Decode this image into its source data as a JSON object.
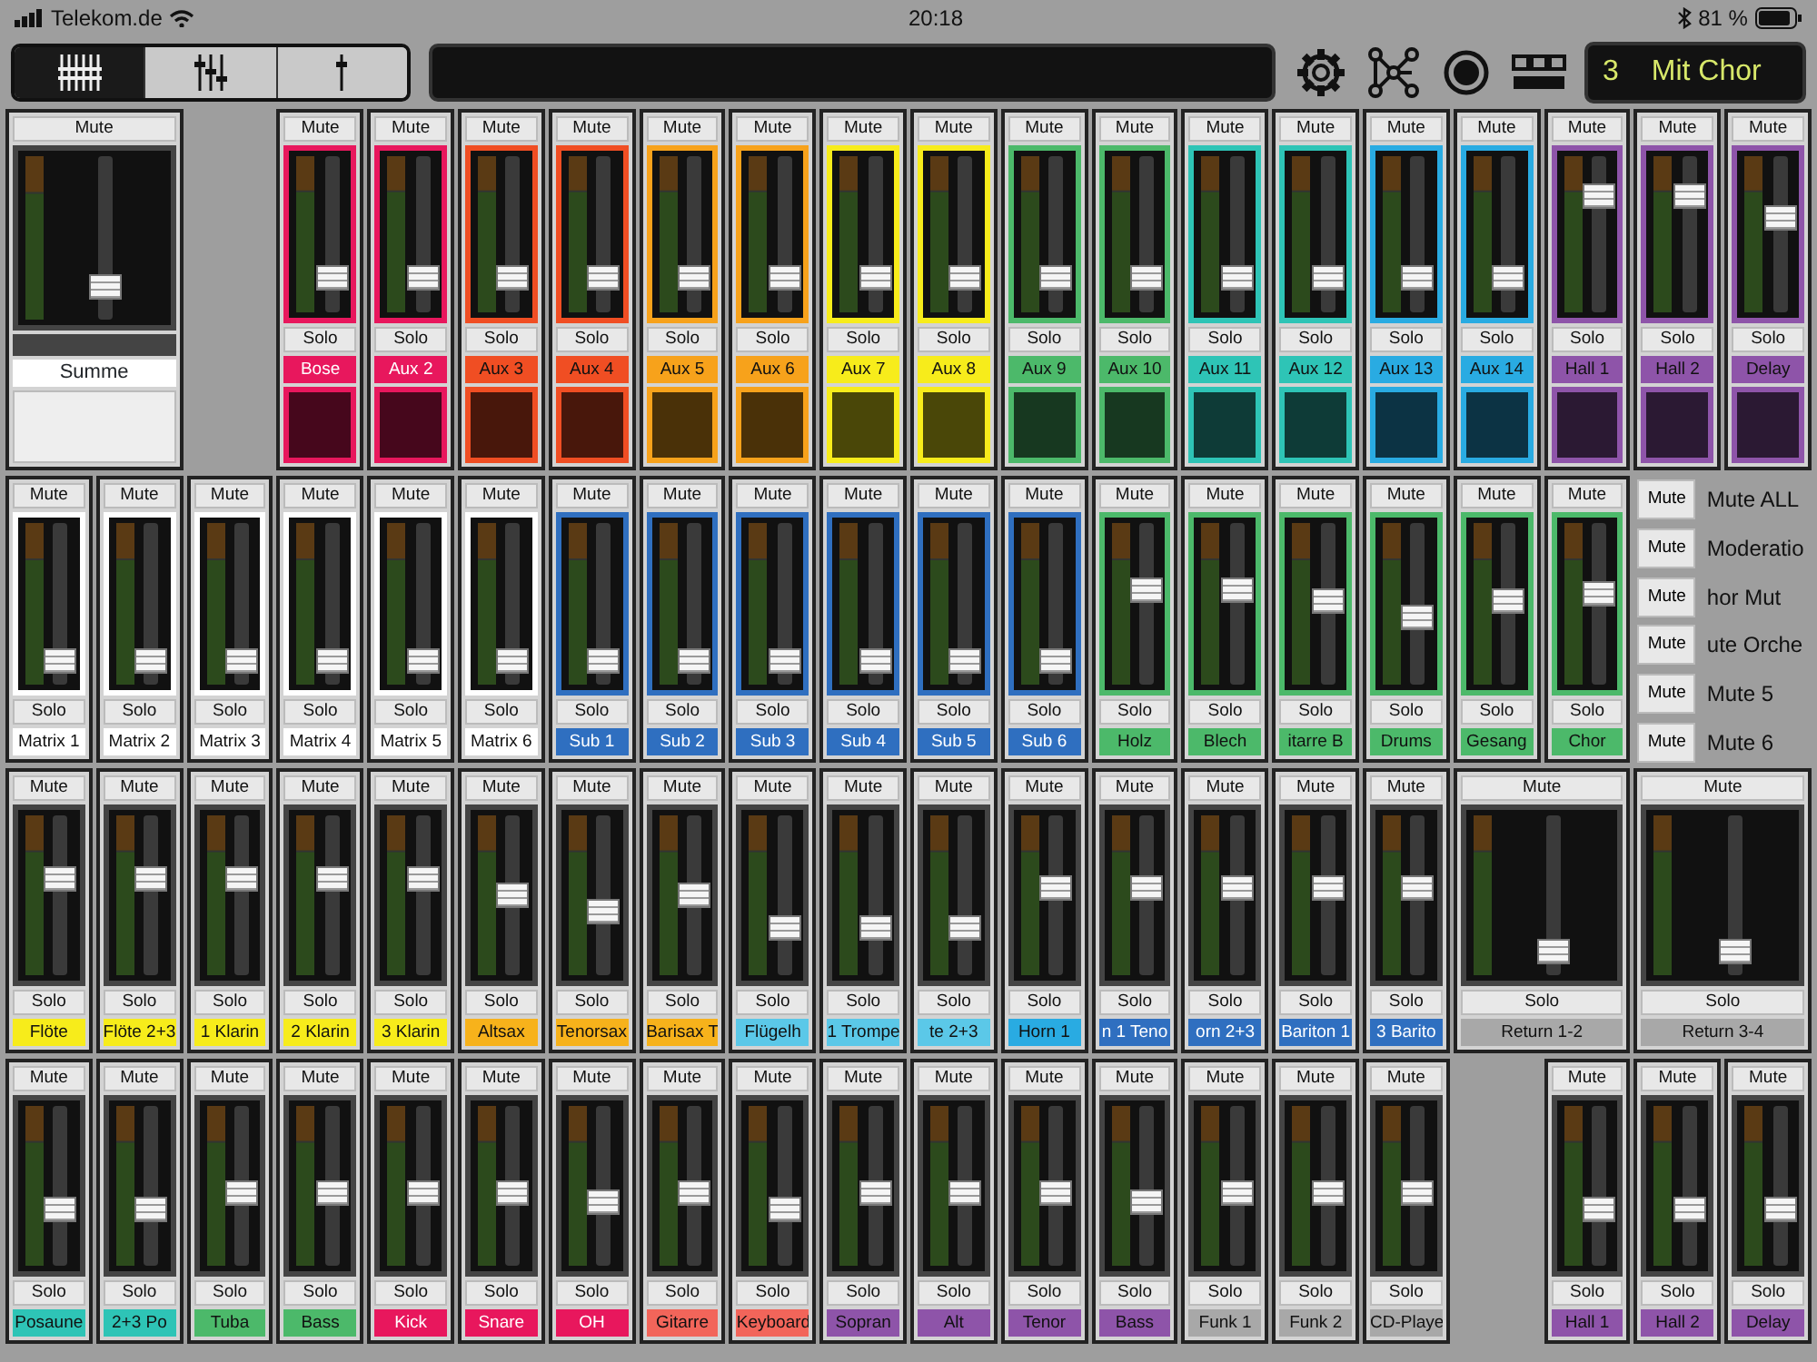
{
  "status_bar": {
    "carrier": "Telekom.de",
    "time": "20:18",
    "battery": "81 %"
  },
  "toolbar": {
    "view_tabs": [
      {
        "kind": "bank",
        "selected": true
      },
      {
        "kind": "group",
        "selected": false
      },
      {
        "kind": "single",
        "selected": false
      }
    ],
    "scene": {
      "number": "3",
      "name": "Mit Chor"
    }
  },
  "master": {
    "mute": "Mute",
    "name": "Summe",
    "level": 0.2
  },
  "rows": [
    {
      "kind": "sends",
      "strips": [
        {
          "kind": "narrow",
          "mute": "Mute",
          "solo": "Solo",
          "name": "Bose",
          "color": "#e8175d",
          "level": 0.22
        },
        {
          "kind": "narrow",
          "mute": "Mute",
          "solo": "Solo",
          "name": "Aux 2",
          "color": "#e8175d",
          "level": 0.22
        },
        {
          "kind": "narrow",
          "mute": "Mute",
          "solo": "Solo",
          "name": "Aux 3",
          "color": "#f04e23",
          "level": 0.22
        },
        {
          "kind": "narrow",
          "mute": "Mute",
          "solo": "Solo",
          "name": "Aux 4",
          "color": "#f04e23",
          "level": 0.22
        },
        {
          "kind": "narrow",
          "mute": "Mute",
          "solo": "Solo",
          "name": "Aux 5",
          "color": "#f7a21b",
          "level": 0.22
        },
        {
          "kind": "narrow",
          "mute": "Mute",
          "solo": "Solo",
          "name": "Aux 6",
          "color": "#f7a21b",
          "level": 0.22
        },
        {
          "kind": "narrow",
          "mute": "Mute",
          "solo": "Solo",
          "name": "Aux 7",
          "color": "#f7ec1b",
          "level": 0.22
        },
        {
          "kind": "narrow",
          "mute": "Mute",
          "solo": "Solo",
          "name": "Aux 8",
          "color": "#f7ec1b",
          "level": 0.22
        },
        {
          "kind": "narrow",
          "mute": "Mute",
          "solo": "Solo",
          "name": "Aux 9",
          "color": "#4cb96a",
          "level": 0.22
        },
        {
          "kind": "narrow",
          "mute": "Mute",
          "solo": "Solo",
          "name": "Aux 10",
          "color": "#4cb96a",
          "level": 0.22
        },
        {
          "kind": "narrow",
          "mute": "Mute",
          "solo": "Solo",
          "name": "Aux 11",
          "color": "#2ec4b6",
          "level": 0.22
        },
        {
          "kind": "narrow",
          "mute": "Mute",
          "solo": "Solo",
          "name": "Aux 12",
          "color": "#2ec4b6",
          "level": 0.22
        },
        {
          "kind": "narrow",
          "mute": "Mute",
          "solo": "Solo",
          "name": "Aux 13",
          "color": "#29abe2",
          "level": 0.22
        },
        {
          "kind": "narrow",
          "mute": "Mute",
          "solo": "Solo",
          "name": "Aux 14",
          "color": "#29abe2",
          "level": 0.22
        },
        {
          "kind": "narrow",
          "mute": "Mute",
          "solo": "Solo",
          "name": "Hall 1",
          "color": "#8e54a9",
          "level": 0.75
        },
        {
          "kind": "narrow",
          "mute": "Mute",
          "solo": "Solo",
          "name": "Hall 2",
          "color": "#8e54a9",
          "level": 0.75
        },
        {
          "kind": "narrow",
          "mute": "Mute",
          "solo": "Solo",
          "name": "Delay",
          "color": "#8e54a9",
          "level": 0.6
        }
      ]
    },
    {
      "kind": "buses",
      "strips": [
        {
          "kind": "narrow",
          "mute": "Mute",
          "solo": "Solo",
          "name": "Matrix 1",
          "color": "#ffffff",
          "level": 0.15
        },
        {
          "kind": "narrow",
          "mute": "Mute",
          "solo": "Solo",
          "name": "Matrix 2",
          "color": "#ffffff",
          "level": 0.15
        },
        {
          "kind": "narrow",
          "mute": "Mute",
          "solo": "Solo",
          "name": "Matrix 3",
          "color": "#ffffff",
          "level": 0.15
        },
        {
          "kind": "narrow",
          "mute": "Mute",
          "solo": "Solo",
          "name": "Matrix 4",
          "color": "#ffffff",
          "level": 0.15
        },
        {
          "kind": "narrow",
          "mute": "Mute",
          "solo": "Solo",
          "name": "Matrix 5",
          "color": "#ffffff",
          "level": 0.15
        },
        {
          "kind": "narrow",
          "mute": "Mute",
          "solo": "Solo",
          "name": "Matrix 6",
          "color": "#ffffff",
          "level": 0.15
        },
        {
          "kind": "narrow",
          "mute": "Mute",
          "solo": "Solo",
          "name": "Sub 1",
          "color": "#2f6fc0",
          "level": 0.15
        },
        {
          "kind": "narrow",
          "mute": "Mute",
          "solo": "Solo",
          "name": "Sub 2",
          "color": "#2f6fc0",
          "level": 0.15
        },
        {
          "kind": "narrow",
          "mute": "Mute",
          "solo": "Solo",
          "name": "Sub 3",
          "color": "#2f6fc0",
          "level": 0.15
        },
        {
          "kind": "narrow",
          "mute": "Mute",
          "solo": "Solo",
          "name": "Sub 4",
          "color": "#2f6fc0",
          "level": 0.15
        },
        {
          "kind": "narrow",
          "mute": "Mute",
          "solo": "Solo",
          "name": "Sub 5",
          "color": "#2f6fc0",
          "level": 0.15
        },
        {
          "kind": "narrow",
          "mute": "Mute",
          "solo": "Solo",
          "name": "Sub 6",
          "color": "#2f6fc0",
          "level": 0.15
        },
        {
          "kind": "narrow",
          "mute": "Mute",
          "solo": "Solo",
          "name": "Holz",
          "color": "#4cb96a",
          "level": 0.58
        },
        {
          "kind": "narrow",
          "mute": "Mute",
          "solo": "Solo",
          "name": "Blech",
          "color": "#4cb96a",
          "level": 0.58
        },
        {
          "kind": "narrow",
          "mute": "Mute",
          "solo": "Solo",
          "name": "itarre B",
          "color": "#4cb96a",
          "level": 0.52
        },
        {
          "kind": "narrow",
          "mute": "Mute",
          "solo": "Solo",
          "name": "Drums",
          "color": "#4cb96a",
          "level": 0.42
        },
        {
          "kind": "narrow",
          "mute": "Mute",
          "solo": "Solo",
          "name": "Gesang",
          "color": "#4cb96a",
          "level": 0.52
        },
        {
          "kind": "narrow",
          "mute": "Mute",
          "solo": "Solo",
          "name": "Chor",
          "color": "#4cb96a",
          "level": 0.56
        }
      ]
    },
    {
      "kind": "inputs",
      "strips": [
        {
          "kind": "narrow",
          "mute": "Mute",
          "solo": "Solo",
          "name": "Flöte",
          "color": "#f7ec1b",
          "level": 0.6
        },
        {
          "kind": "narrow",
          "mute": "Mute",
          "solo": "Solo",
          "name": "Flöte 2+3",
          "color": "#f7ec1b",
          "level": 0.6
        },
        {
          "kind": "narrow",
          "mute": "Mute",
          "solo": "Solo",
          "name": "1 Klarin",
          "color": "#f7ec1b",
          "level": 0.6
        },
        {
          "kind": "narrow",
          "mute": "Mute",
          "solo": "Solo",
          "name": "2 Klarin",
          "color": "#f7ec1b",
          "level": 0.6
        },
        {
          "kind": "narrow",
          "mute": "Mute",
          "solo": "Solo",
          "name": "3 Klarin",
          "color": "#f7ec1b",
          "level": 0.6
        },
        {
          "kind": "narrow",
          "mute": "Mute",
          "solo": "Solo",
          "name": "Altsax",
          "color": "#f7b21b",
          "level": 0.5
        },
        {
          "kind": "narrow",
          "mute": "Mute",
          "solo": "Solo",
          "name": "Tenorsax",
          "color": "#f7b21b",
          "level": 0.4
        },
        {
          "kind": "narrow",
          "mute": "Mute",
          "solo": "Solo",
          "name": "Barisax T",
          "color": "#f7b21b",
          "level": 0.5
        },
        {
          "kind": "narrow",
          "mute": "Mute",
          "solo": "Solo",
          "name": "Flügelh",
          "color": "#5bc8e8",
          "level": 0.3
        },
        {
          "kind": "narrow",
          "mute": "Mute",
          "solo": "Solo",
          "name": "1 Trompe",
          "color": "#5bc8e8",
          "level": 0.3
        },
        {
          "kind": "narrow",
          "mute": "Mute",
          "solo": "Solo",
          "name": "te 2+3",
          "color": "#5bc8e8",
          "level": 0.3
        },
        {
          "kind": "narrow",
          "mute": "Mute",
          "solo": "Solo",
          "name": "Horn 1",
          "color": "#29abe2",
          "level": 0.55
        },
        {
          "kind": "narrow",
          "mute": "Mute",
          "solo": "Solo",
          "name": "n 1 Teno",
          "color": "#2f6fc0",
          "level": 0.55
        },
        {
          "kind": "narrow",
          "mute": "Mute",
          "solo": "Solo",
          "name": "orn 2+3",
          "color": "#2f6fc0",
          "level": 0.55
        },
        {
          "kind": "narrow",
          "mute": "Mute",
          "solo": "Solo",
          "name": "Bariton 1",
          "color": "#2f6fc0",
          "level": 0.55
        },
        {
          "kind": "narrow",
          "mute": "Mute",
          "solo": "Solo",
          "name": "3 Barito",
          "color": "#2f6fc0",
          "level": 0.55
        },
        {
          "kind": "wide",
          "mute": "Mute",
          "solo": "Solo",
          "name": "Return 1-2",
          "color": "#a8a8a8",
          "level": 0.15
        },
        {
          "kind": "wide",
          "mute": "Mute",
          "solo": "Solo",
          "name": "Return 3-4",
          "color": "#a8a8a8",
          "level": 0.15
        }
      ]
    },
    {
      "kind": "inputs",
      "strips": [
        {
          "kind": "narrow",
          "mute": "Mute",
          "solo": "Solo",
          "name": "Posaune",
          "color": "#2ec4b6",
          "level": 0.35
        },
        {
          "kind": "narrow",
          "mute": "Mute",
          "solo": "Solo",
          "name": "2+3 Po",
          "color": "#2ec4b6",
          "level": 0.35
        },
        {
          "kind": "narrow",
          "mute": "Mute",
          "solo": "Solo",
          "name": "Tuba",
          "color": "#4cb96a",
          "level": 0.45
        },
        {
          "kind": "narrow",
          "mute": "Mute",
          "solo": "Solo",
          "name": "Bass",
          "color": "#4cb96a",
          "level": 0.45
        },
        {
          "kind": "narrow",
          "mute": "Mute",
          "solo": "Solo",
          "name": "Kick",
          "color": "#e8175d",
          "level": 0.45
        },
        {
          "kind": "narrow",
          "mute": "Mute",
          "solo": "Solo",
          "name": "Snare",
          "color": "#e8175d",
          "level": 0.45
        },
        {
          "kind": "narrow",
          "mute": "Mute",
          "solo": "Solo",
          "name": "OH",
          "color": "#e8175d",
          "level": 0.4
        },
        {
          "kind": "narrow",
          "mute": "Mute",
          "solo": "Solo",
          "name": "Gitarre",
          "color": "#f2655a",
          "level": 0.45
        },
        {
          "kind": "narrow",
          "mute": "Mute",
          "solo": "Solo",
          "name": "Keyboard",
          "color": "#f2655a",
          "level": 0.35
        },
        {
          "kind": "narrow",
          "mute": "Mute",
          "solo": "Solo",
          "name": "Sopran",
          "color": "#8e54a9",
          "level": 0.45
        },
        {
          "kind": "narrow",
          "mute": "Mute",
          "solo": "Solo",
          "name": "Alt",
          "color": "#8e54a9",
          "level": 0.45
        },
        {
          "kind": "narrow",
          "mute": "Mute",
          "solo": "Solo",
          "name": "Tenor",
          "color": "#8e54a9",
          "level": 0.45
        },
        {
          "kind": "narrow",
          "mute": "Mute",
          "solo": "Solo",
          "name": "Bass",
          "color": "#8e54a9",
          "level": 0.4
        },
        {
          "kind": "narrow",
          "mute": "Mute",
          "solo": "Solo",
          "name": "Funk 1",
          "color": "#a8a8a8",
          "level": 0.45
        },
        {
          "kind": "narrow",
          "mute": "Mute",
          "solo": "Solo",
          "name": "Funk 2",
          "color": "#a8a8a8",
          "level": 0.45
        },
        {
          "kind": "narrow",
          "mute": "Mute",
          "solo": "Solo",
          "name": "CD-Playe",
          "color": "#a8a8a8",
          "level": 0.45
        },
        {
          "kind": "narrow",
          "mute": "Mute",
          "solo": "Solo",
          "name": "Hall 1",
          "color": "#8e54a9",
          "level": 0.35
        },
        {
          "kind": "narrow",
          "mute": "Mute",
          "solo": "Solo",
          "name": "Hall 2",
          "color": "#8e54a9",
          "level": 0.35
        },
        {
          "kind": "narrow",
          "mute": "Mute",
          "solo": "Solo",
          "name": "Delay",
          "color": "#8e54a9",
          "level": 0.35
        }
      ]
    }
  ],
  "mute_groups": [
    {
      "button": "Mute",
      "label": "Mute ALL"
    },
    {
      "button": "Mute",
      "label": "Moderatio"
    },
    {
      "button": "Mute",
      "label": "hor Mut"
    },
    {
      "button": "Mute",
      "label": "ute Orche"
    },
    {
      "button": "Mute",
      "label": "Mute 5"
    },
    {
      "button": "Mute",
      "label": "Mute 6"
    }
  ]
}
